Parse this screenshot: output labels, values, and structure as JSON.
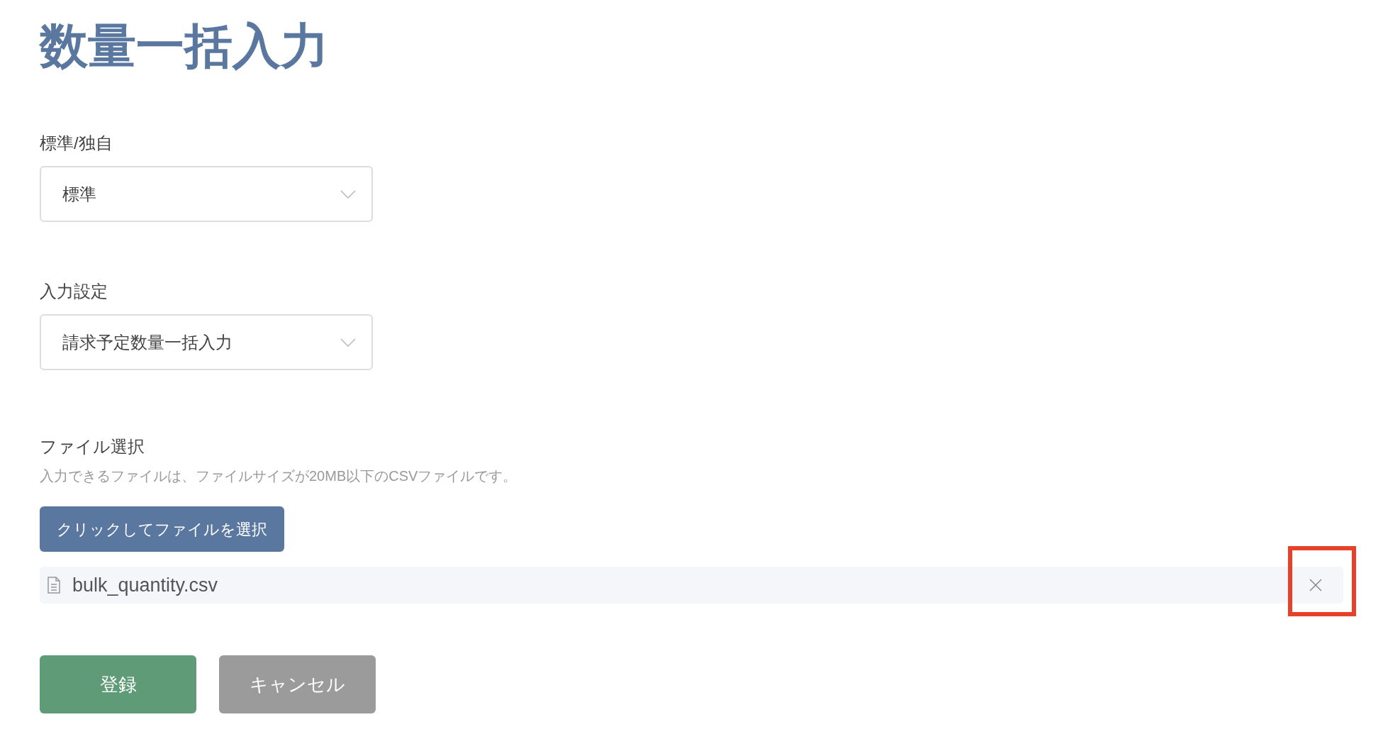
{
  "title": "数量一括入力",
  "selects": [
    {
      "label": "標準/独自",
      "value": "標準"
    },
    {
      "label": "入力設定",
      "value": "請求予定数量一括入力"
    }
  ],
  "file_select": {
    "label": "ファイル選択",
    "help": "入力できるファイルは、ファイルサイズが20MB以下のCSVファイルです。",
    "button": "クリックしてファイルを選択",
    "file": {
      "name": "bulk_quantity.csv",
      "highlighted": true
    }
  },
  "buttons": [
    {
      "label": "登録",
      "kind": "primary"
    },
    {
      "label": "キャンセル",
      "kind": "secondary"
    }
  ]
}
